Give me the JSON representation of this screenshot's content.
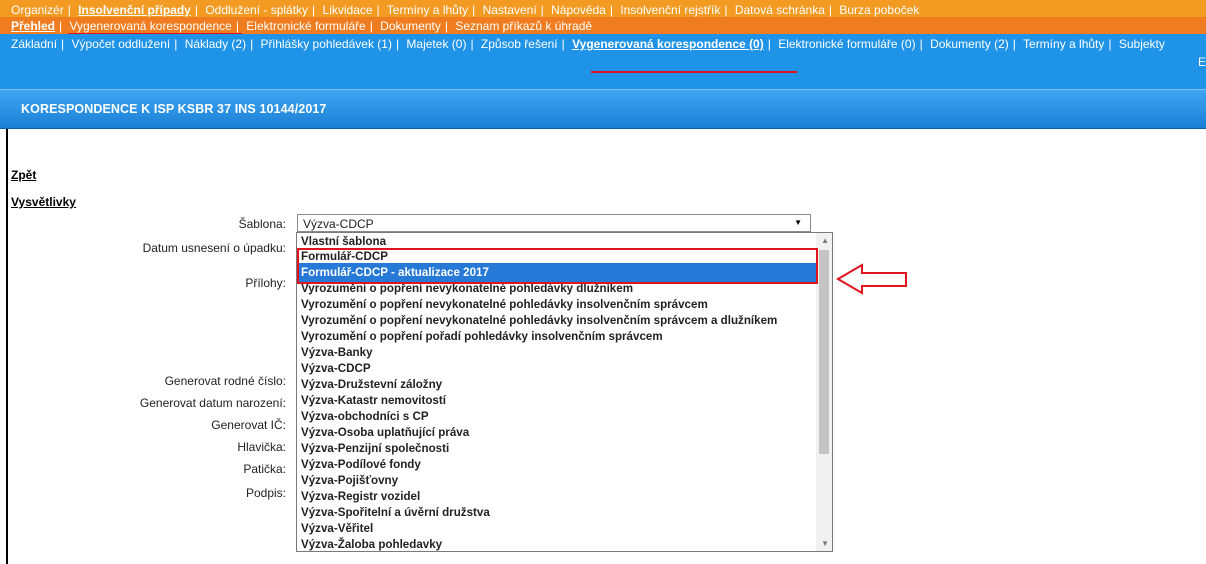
{
  "nav1": [
    "Organizér",
    "Insolvenční případy",
    "Oddlužení - splátky",
    "Likvidace",
    "Termíny a lhůty",
    "Nastavení",
    "Nápověda",
    "Insolvenční rejstřík",
    "Datová schránka",
    "Burza poboček"
  ],
  "nav2": [
    "Přehled",
    "Vygenerovaná korespondence",
    "Elektronické formuláře",
    "Dokumenty",
    "Seznam příkazů k úhradě"
  ],
  "nav3": [
    "Základní",
    "Výpočet oddlužení",
    "Náklady (2)",
    "Přihlášky pohledávek (1)",
    "Majetek (0)",
    "Způsob řešení",
    "Vygenerovaná korespondence (0)",
    "Elektronické formuláře (0)",
    "Dokumenty (2)",
    "Termíny a lhůty",
    "Subjekty"
  ],
  "nav3_wrap": "E",
  "header_title": "KORESPONDENCE K ISP KSBR 37 INS 10144/2017",
  "back_link": "Zpět",
  "explain_link": "Vysvětlivky",
  "form": {
    "sablona_label": "Šablona:",
    "sablona_value": "Výzva-CDCP",
    "datum_label": "Datum usnesení o úpadku:",
    "prilohy_label": "Přílohy:",
    "rodne_label": "Generovat rodné číslo:",
    "narozeni_label": "Generovat datum narození:",
    "ic_label": "Generovat IČ:",
    "hlavicka_label": "Hlavička:",
    "paticka_label": "Patička:",
    "podpis_label": "Podpis:"
  },
  "dropdown": {
    "options": [
      "Vlastní šablona",
      "Formulář-CDCP",
      "Formulář-CDCP - aktualizace 2017",
      "Vyrozumění o popření nevykonatelné pohledávky dlužníkem",
      "Vyrozumění o popření nevykonatelné pohledávky insolvenčním správcem",
      "Vyrozumění o popření nevykonatelné pohledávky insolvenčním správcem a dlužníkem",
      "Vyrozumění o popření pořadí pohledávky insolvenčním správcem",
      "Výzva-Banky",
      "Výzva-CDCP",
      "Výzva-Družstevní záložny",
      "Výzva-Katastr nemovitostí",
      "Výzva-obchodníci s CP",
      "Výzva-Osoba uplatňující práva",
      "Výzva-Penzijní společnosti",
      "Výzva-Podílové fondy",
      "Výzva-Pojišťovny",
      "Výzva-Registr vozidel",
      "Výzva-Spořitelní a úvěrní družstva",
      "Výzva-Věřitel",
      "Výzva-Žaloba pohledavky"
    ],
    "selected_index": 2
  },
  "colors": {
    "nav1_bg": "#f29a22",
    "nav2_bg": "#ef7d1f",
    "nav3_bg": "#1f93e8",
    "selection": "#2679d6",
    "highlight_red": "#e0141e"
  }
}
